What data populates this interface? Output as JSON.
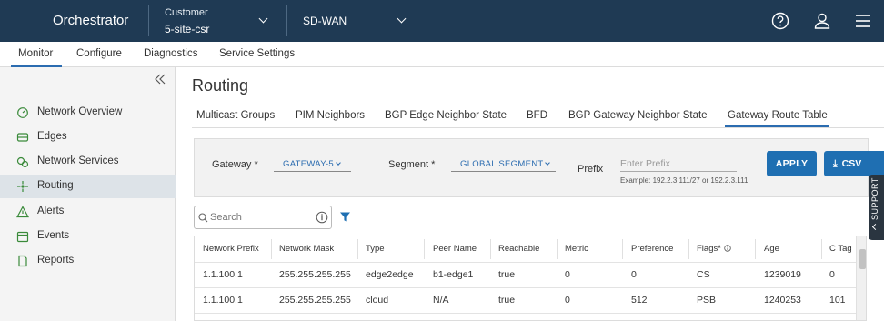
{
  "app": {
    "title": "Orchestrator",
    "customer_label": "Customer",
    "customer_value": "5-site-csr",
    "product": "SD-WAN",
    "icons": [
      "help-icon",
      "user-icon",
      "menu-icon"
    ],
    "accent_color": "#1f6fb2",
    "topbar_color": "#1f3a54"
  },
  "subnav": {
    "items": [
      "Monitor",
      "Configure",
      "Diagnostics",
      "Service Settings"
    ],
    "active": "Monitor"
  },
  "sidebar": {
    "items": [
      {
        "label": "Network Overview",
        "icon": "network-overview-icon"
      },
      {
        "label": "Edges",
        "icon": "edges-icon"
      },
      {
        "label": "Network Services",
        "icon": "network-services-icon"
      },
      {
        "label": "Routing",
        "icon": "routing-icon"
      },
      {
        "label": "Alerts",
        "icon": "alert-icon"
      },
      {
        "label": "Events",
        "icon": "events-icon"
      },
      {
        "label": "Reports",
        "icon": "reports-icon"
      }
    ],
    "active": "Routing"
  },
  "page": {
    "title": "Routing",
    "tabs": [
      "Multicast Groups",
      "PIM Neighbors",
      "BGP Edge Neighbor State",
      "BFD",
      "BGP Gateway Neighbor State",
      "Gateway Route Table"
    ],
    "active_tab": "Gateway Route Table"
  },
  "filters": {
    "gateway_label": "Gateway",
    "gateway_value": "GATEWAY-5",
    "segment_label": "Segment",
    "segment_value": "GLOBAL SEGMENT",
    "required_mark": "*",
    "prefix_label": "Prefix",
    "prefix_placeholder": "Enter Prefix",
    "prefix_example": "Example: 192.2.3.111/27 or 192.2.3.111",
    "apply_label": "APPLY",
    "csv_label": "CSV"
  },
  "search": {
    "placeholder": "Search"
  },
  "table": {
    "columns": [
      "Network Prefix",
      "Network Mask",
      "Type",
      "Peer Name",
      "Reachable",
      "Metric",
      "Preference",
      "Flags*",
      "Age",
      "C Tag"
    ],
    "rows": [
      [
        "1.1.100.1",
        "255.255.255.255",
        "edge2edge",
        "b1-edge1",
        "true",
        "0",
        "0",
        "CS",
        "1239019",
        "0"
      ],
      [
        "1.1.100.1",
        "255.255.255.255",
        "cloud",
        "N/A",
        "true",
        "0",
        "512",
        "PSB",
        "1240253",
        "101"
      ]
    ]
  },
  "support": {
    "label": "SUPPORT"
  }
}
